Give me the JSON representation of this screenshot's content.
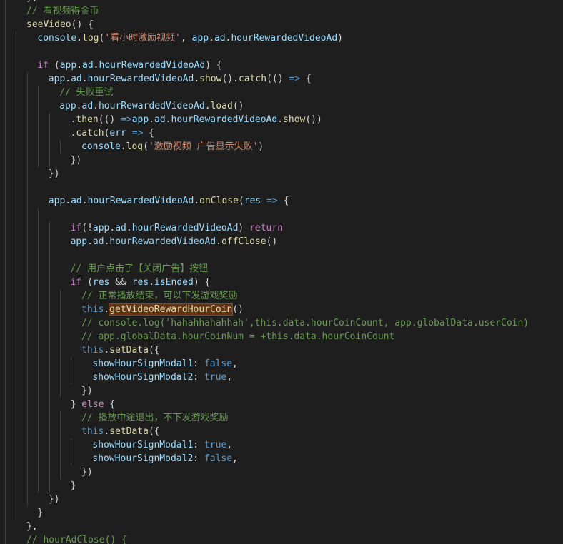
{
  "editor": {
    "language": "javascript",
    "theme": "dark",
    "colors": {
      "background": "#1e1e1e",
      "text": "#d4d4d4",
      "keyword": "#c586c0",
      "storage": "#569cd6",
      "function": "#dcdcaa",
      "variable": "#9cdcfe",
      "string": "#ce9178",
      "comment": "#6a9955",
      "highlight": "#613214"
    },
    "lines": [
      {
        "indent": 2,
        "tokens": [
          {
            "t": "p",
            "v": "},"
          }
        ]
      },
      {
        "indent": 2,
        "tokens": [
          {
            "t": "c",
            "v": "// 看视频得金币"
          }
        ]
      },
      {
        "indent": 2,
        "tokens": [
          {
            "t": "f",
            "v": "seeVideo"
          },
          {
            "t": "p",
            "v": "() {"
          }
        ]
      },
      {
        "indent": 3,
        "tokens": [
          {
            "t": "v",
            "v": "console"
          },
          {
            "t": "p",
            "v": "."
          },
          {
            "t": "f",
            "v": "log"
          },
          {
            "t": "p",
            "v": "("
          },
          {
            "t": "s",
            "v": "'看小时激励视频'"
          },
          {
            "t": "p",
            "v": ", "
          },
          {
            "t": "v",
            "v": "app"
          },
          {
            "t": "p",
            "v": "."
          },
          {
            "t": "v",
            "v": "ad"
          },
          {
            "t": "p",
            "v": "."
          },
          {
            "t": "v",
            "v": "hourRewardedVideoAd"
          },
          {
            "t": "p",
            "v": ")"
          }
        ]
      },
      {
        "indent": 3,
        "tokens": []
      },
      {
        "indent": 3,
        "tokens": [
          {
            "t": "k",
            "v": "if"
          },
          {
            "t": "p",
            "v": " ("
          },
          {
            "t": "v",
            "v": "app"
          },
          {
            "t": "p",
            "v": "."
          },
          {
            "t": "v",
            "v": "ad"
          },
          {
            "t": "p",
            "v": "."
          },
          {
            "t": "v",
            "v": "hourRewardedVideoAd"
          },
          {
            "t": "p",
            "v": ") {"
          }
        ]
      },
      {
        "indent": 4,
        "tokens": [
          {
            "t": "v",
            "v": "app"
          },
          {
            "t": "p",
            "v": "."
          },
          {
            "t": "v",
            "v": "ad"
          },
          {
            "t": "p",
            "v": "."
          },
          {
            "t": "v",
            "v": "hourRewardedVideoAd"
          },
          {
            "t": "p",
            "v": "."
          },
          {
            "t": "f",
            "v": "show"
          },
          {
            "t": "p",
            "v": "()."
          },
          {
            "t": "f",
            "v": "catch"
          },
          {
            "t": "p",
            "v": "(() "
          },
          {
            "t": "b",
            "v": "=>"
          },
          {
            "t": "p",
            "v": " {"
          }
        ]
      },
      {
        "indent": 5,
        "tokens": [
          {
            "t": "c",
            "v": "// 失败重试"
          }
        ]
      },
      {
        "indent": 5,
        "tokens": [
          {
            "t": "v",
            "v": "app"
          },
          {
            "t": "p",
            "v": "."
          },
          {
            "t": "v",
            "v": "ad"
          },
          {
            "t": "p",
            "v": "."
          },
          {
            "t": "v",
            "v": "hourRewardedVideoAd"
          },
          {
            "t": "p",
            "v": "."
          },
          {
            "t": "f",
            "v": "load"
          },
          {
            "t": "p",
            "v": "()"
          }
        ]
      },
      {
        "indent": 6,
        "tokens": [
          {
            "t": "p",
            "v": "."
          },
          {
            "t": "f",
            "v": "then"
          },
          {
            "t": "p",
            "v": "(() "
          },
          {
            "t": "b",
            "v": "=>"
          },
          {
            "t": "v",
            "v": "app"
          },
          {
            "t": "p",
            "v": "."
          },
          {
            "t": "v",
            "v": "ad"
          },
          {
            "t": "p",
            "v": "."
          },
          {
            "t": "v",
            "v": "hourRewardedVideoAd"
          },
          {
            "t": "p",
            "v": "."
          },
          {
            "t": "f",
            "v": "show"
          },
          {
            "t": "p",
            "v": "())"
          }
        ]
      },
      {
        "indent": 6,
        "tokens": [
          {
            "t": "p",
            "v": "."
          },
          {
            "t": "f",
            "v": "catch"
          },
          {
            "t": "p",
            "v": "("
          },
          {
            "t": "v",
            "v": "err"
          },
          {
            "t": "p",
            "v": " "
          },
          {
            "t": "b",
            "v": "=>"
          },
          {
            "t": "p",
            "v": " {"
          }
        ]
      },
      {
        "indent": 7,
        "tokens": [
          {
            "t": "v",
            "v": "console"
          },
          {
            "t": "p",
            "v": "."
          },
          {
            "t": "f",
            "v": "log"
          },
          {
            "t": "p",
            "v": "("
          },
          {
            "t": "s",
            "v": "'激励视频 广告显示失败'"
          },
          {
            "t": "p",
            "v": ")"
          }
        ]
      },
      {
        "indent": 6,
        "tokens": [
          {
            "t": "p",
            "v": "})"
          }
        ]
      },
      {
        "indent": 4,
        "tokens": [
          {
            "t": "p",
            "v": "})"
          }
        ]
      },
      {
        "indent": 4,
        "tokens": []
      },
      {
        "indent": 4,
        "tokens": [
          {
            "t": "v",
            "v": "app"
          },
          {
            "t": "p",
            "v": "."
          },
          {
            "t": "v",
            "v": "ad"
          },
          {
            "t": "p",
            "v": "."
          },
          {
            "t": "v",
            "v": "hourRewardedVideoAd"
          },
          {
            "t": "p",
            "v": "."
          },
          {
            "t": "f",
            "v": "onClose"
          },
          {
            "t": "p",
            "v": "("
          },
          {
            "t": "v",
            "v": "res"
          },
          {
            "t": "p",
            "v": " "
          },
          {
            "t": "b",
            "v": "=>"
          },
          {
            "t": "p",
            "v": " {"
          }
        ]
      },
      {
        "indent": 5,
        "tokens": []
      },
      {
        "indent": 6,
        "tokens": [
          {
            "t": "k",
            "v": "if"
          },
          {
            "t": "p",
            "v": "(!"
          },
          {
            "t": "v",
            "v": "app"
          },
          {
            "t": "p",
            "v": "."
          },
          {
            "t": "v",
            "v": "ad"
          },
          {
            "t": "p",
            "v": "."
          },
          {
            "t": "v",
            "v": "hourRewardedVideoAd"
          },
          {
            "t": "p",
            "v": ") "
          },
          {
            "t": "k",
            "v": "return"
          }
        ]
      },
      {
        "indent": 6,
        "tokens": [
          {
            "t": "v",
            "v": "app"
          },
          {
            "t": "p",
            "v": "."
          },
          {
            "t": "v",
            "v": "ad"
          },
          {
            "t": "p",
            "v": "."
          },
          {
            "t": "v",
            "v": "hourRewardedVideoAd"
          },
          {
            "t": "p",
            "v": "."
          },
          {
            "t": "f",
            "v": "offClose"
          },
          {
            "t": "p",
            "v": "()"
          }
        ]
      },
      {
        "indent": 6,
        "tokens": []
      },
      {
        "indent": 6,
        "tokens": [
          {
            "t": "c",
            "v": "// 用户点击了【关闭广告】按钮"
          }
        ]
      },
      {
        "indent": 6,
        "tokens": [
          {
            "t": "k",
            "v": "if"
          },
          {
            "t": "p",
            "v": " ("
          },
          {
            "t": "v",
            "v": "res"
          },
          {
            "t": "p",
            "v": " && "
          },
          {
            "t": "v",
            "v": "res"
          },
          {
            "t": "p",
            "v": "."
          },
          {
            "t": "v",
            "v": "isEnded"
          },
          {
            "t": "p",
            "v": ") {"
          }
        ]
      },
      {
        "indent": 7,
        "tokens": [
          {
            "t": "c",
            "v": "// 正常播放结束，可以下发游戏奖励"
          }
        ]
      },
      {
        "indent": 7,
        "tokens": [
          {
            "t": "b",
            "v": "this"
          },
          {
            "t": "p",
            "v": "."
          },
          {
            "t": "fh",
            "v": "getVideoRewardHourCoin"
          },
          {
            "t": "p",
            "v": "()"
          }
        ]
      },
      {
        "indent": 7,
        "tokens": [
          {
            "t": "c",
            "v": "// console.log('hahahhahahhah',this.data.hourCoinCount, app.globalData.userCoin)"
          }
        ]
      },
      {
        "indent": 7,
        "tokens": [
          {
            "t": "c",
            "v": "// app.globalData.hourCoinNum = +this.data.hourCoinCount"
          }
        ]
      },
      {
        "indent": 7,
        "tokens": [
          {
            "t": "b",
            "v": "this"
          },
          {
            "t": "p",
            "v": "."
          },
          {
            "t": "f",
            "v": "setData"
          },
          {
            "t": "p",
            "v": "({"
          }
        ]
      },
      {
        "indent": 8,
        "tokens": [
          {
            "t": "v",
            "v": "showHourSignModal1"
          },
          {
            "t": "p",
            "v": ": "
          },
          {
            "t": "b",
            "v": "false"
          },
          {
            "t": "p",
            "v": ","
          }
        ]
      },
      {
        "indent": 8,
        "tokens": [
          {
            "t": "v",
            "v": "showHourSignModal2"
          },
          {
            "t": "p",
            "v": ": "
          },
          {
            "t": "b",
            "v": "true"
          },
          {
            "t": "p",
            "v": ","
          }
        ]
      },
      {
        "indent": 7,
        "tokens": [
          {
            "t": "p",
            "v": "})"
          }
        ]
      },
      {
        "indent": 6,
        "tokens": [
          {
            "t": "p",
            "v": "} "
          },
          {
            "t": "k",
            "v": "else"
          },
          {
            "t": "p",
            "v": " {"
          }
        ]
      },
      {
        "indent": 7,
        "tokens": [
          {
            "t": "c",
            "v": "// 播放中途退出，不下发游戏奖励"
          }
        ]
      },
      {
        "indent": 7,
        "tokens": [
          {
            "t": "b",
            "v": "this"
          },
          {
            "t": "p",
            "v": "."
          },
          {
            "t": "f",
            "v": "setData"
          },
          {
            "t": "p",
            "v": "({"
          }
        ]
      },
      {
        "indent": 8,
        "tokens": [
          {
            "t": "v",
            "v": "showHourSignModal1"
          },
          {
            "t": "p",
            "v": ": "
          },
          {
            "t": "b",
            "v": "true"
          },
          {
            "t": "p",
            "v": ","
          }
        ]
      },
      {
        "indent": 8,
        "tokens": [
          {
            "t": "v",
            "v": "showHourSignModal2"
          },
          {
            "t": "p",
            "v": ": "
          },
          {
            "t": "b",
            "v": "false"
          },
          {
            "t": "p",
            "v": ","
          }
        ]
      },
      {
        "indent": 7,
        "tokens": [
          {
            "t": "p",
            "v": "})"
          }
        ]
      },
      {
        "indent": 6,
        "tokens": [
          {
            "t": "p",
            "v": "}"
          }
        ]
      },
      {
        "indent": 4,
        "tokens": [
          {
            "t": "p",
            "v": "})"
          }
        ]
      },
      {
        "indent": 3,
        "tokens": [
          {
            "t": "p",
            "v": "}"
          }
        ]
      },
      {
        "indent": 2,
        "tokens": [
          {
            "t": "p",
            "v": "},"
          }
        ]
      },
      {
        "indent": 2,
        "tokens": [
          {
            "t": "c",
            "v": "// hourAdClose() {"
          }
        ]
      }
    ]
  }
}
